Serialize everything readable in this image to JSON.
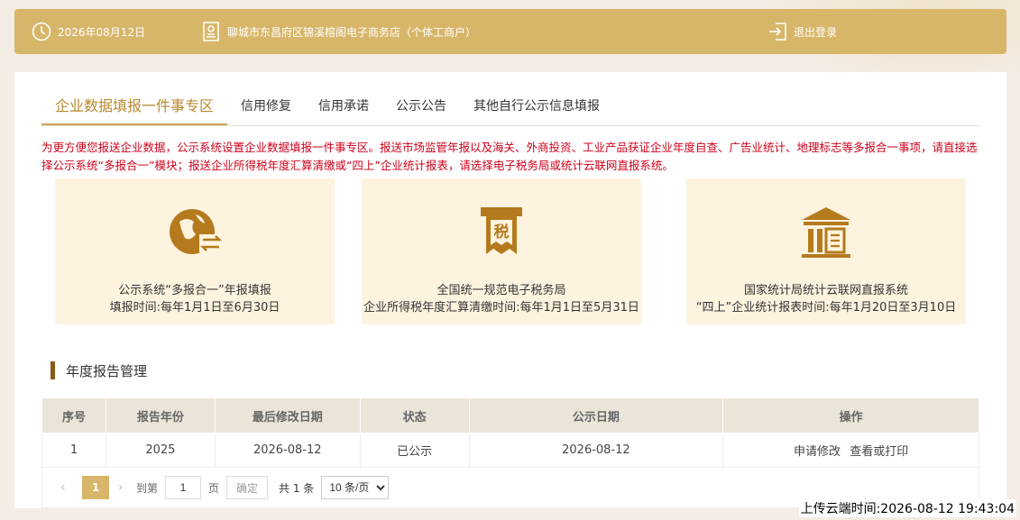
{
  "topbar": {
    "date": "2026年08月12日",
    "shop_name": "聊城市东昌府区锦溪榕阁电子商务店（个体工商户）",
    "logout": "退出登录"
  },
  "tabs": [
    {
      "label": "企业数据填报一件事专区",
      "active": true
    },
    {
      "label": "信用修复"
    },
    {
      "label": "信用承诺"
    },
    {
      "label": "公示公告"
    },
    {
      "label": "其他自行公示信息填报"
    }
  ],
  "notice": "为更方便您报送企业数据，公示系统设置企业数据填报一件事专区。报送市场监管年报以及海关、外商投资、工业产品获证企业年度自查、广告业统计、地理标志等多报合一事项，请直接选择公示系统“多报合一”模块；报送企业所得税年度汇算清缴或“四上”企业统计报表，请选择电子税务局或统计云联网直报系统。",
  "cards": [
    {
      "icon": "globe-exchange-icon",
      "line1": "公示系统“多报合一”年报填报",
      "line2": "填报时间:每年1月1日至6月30日"
    },
    {
      "icon": "tax-bureau-icon",
      "icon_text": "税",
      "line1": "全国统一规范电子税务局",
      "line2": "企业所得税年度汇算清缴时间:每年1月1日至5月31日"
    },
    {
      "icon": "statistics-building-icon",
      "line1": "国家统计局统计云联网直报系统",
      "line2": "“四上”企业统计报表时间:每年1月20日至3月10日"
    }
  ],
  "section_title": "年度报告管理",
  "table": {
    "headers": [
      "序号",
      "报告年份",
      "最后修改日期",
      "状态",
      "公示日期",
      "操作"
    ],
    "rows": [
      {
        "index": "1",
        "year": "2025",
        "modified": "2026-08-12",
        "status": "已公示",
        "public_date": "2026-08-12",
        "op1": "申请修改",
        "op2": "查看或打印"
      }
    ]
  },
  "pager": {
    "current_page": "1",
    "goto_label": "到第",
    "goto_value": "1",
    "page_unit": "页",
    "confirm": "确定",
    "total": "共 1 条",
    "page_size": "10 条/页"
  },
  "upload_time": "上传云端时间:2026-08-12 19:43:04",
  "colors": {
    "gold": "#d7b669",
    "notice_red": "#d0021b",
    "card_bg": "#fdf3df",
    "icon_brown": "#b57a1d"
  }
}
